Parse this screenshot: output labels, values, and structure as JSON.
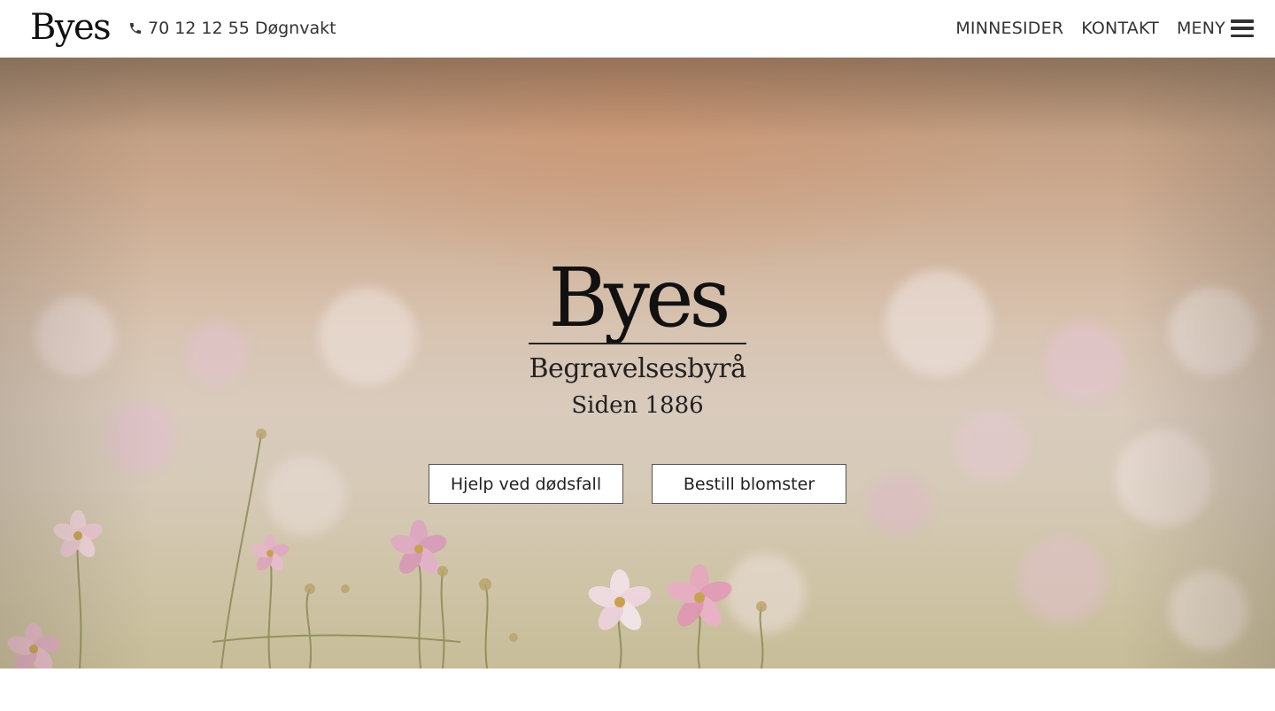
{
  "header": {
    "brand": "Byes",
    "phone": "70 12 12 55 Døgnvakt",
    "nav": {
      "memorial_pages": "MINNESIDER",
      "contact": "KONTAKT",
      "menu": "MENY"
    }
  },
  "hero": {
    "logo": {
      "name": "Byes",
      "subtitle": "Begravelsesbyrå",
      "since": "Siden 1886"
    },
    "buttons": {
      "help": "Hjelp ved dødsfall",
      "order_flowers": "Bestill blomster"
    }
  },
  "icons": {
    "phone": "phone-icon",
    "menu": "hamburger-menu-icon"
  },
  "colors": {
    "text": "#222222",
    "header_bg": "#ffffff",
    "button_bg": "#ffffff",
    "button_border": "#555555"
  }
}
